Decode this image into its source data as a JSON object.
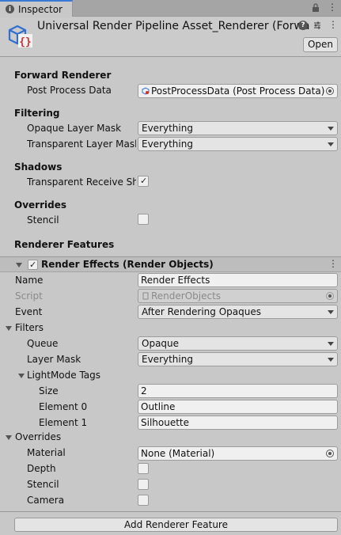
{
  "tab": {
    "label": "Inspector"
  },
  "header": {
    "title": "Universal Render Pipeline Asset_Renderer (Forward Renderer)",
    "open_label": "Open"
  },
  "forward_renderer": {
    "section": "Forward Renderer",
    "post_process_label": "Post Process Data",
    "post_process_value": "PostProcessData (Post Process Data)"
  },
  "filtering": {
    "section": "Filtering",
    "opaque_label": "Opaque Layer Mask",
    "opaque_value": "Everything",
    "transparent_label": "Transparent Layer Mask",
    "transparent_value": "Everything"
  },
  "shadows": {
    "section": "Shadows",
    "receive_label": "Transparent Receive Shadows",
    "receive_checked": true
  },
  "overrides_top": {
    "section": "Overrides",
    "stencil_label": "Stencil",
    "stencil_checked": false
  },
  "renderer_features": {
    "section": "Renderer Features"
  },
  "feature": {
    "title": "Render Effects (Render Objects)",
    "enabled": true,
    "name_label": "Name",
    "name_value": "Render Effects",
    "script_label": "Script",
    "script_value": "RenderObjects",
    "event_label": "Event",
    "event_value": "After Rendering Opaques",
    "filters_label": "Filters",
    "queue_label": "Queue",
    "queue_value": "Opaque",
    "layer_mask_label": "Layer Mask",
    "layer_mask_value": "Everything",
    "lightmode_label": "LightMode Tags",
    "size_label": "Size",
    "size_value": "2",
    "element0_label": "Element 0",
    "element0_value": "Outline",
    "element1_label": "Element 1",
    "element1_value": "Silhouette",
    "overrides_label": "Overrides",
    "material_label": "Material",
    "material_value": "None (Material)",
    "depth_label": "Depth",
    "stencil_label": "Stencil",
    "camera_label": "Camera"
  },
  "footer": {
    "add_feature_label": "Add Renderer Feature"
  },
  "colors": {
    "tab_accent": "#3a79d6",
    "asset_icon_blue": "#2f6fd0",
    "asset_icon_red": "#d32f2f"
  }
}
